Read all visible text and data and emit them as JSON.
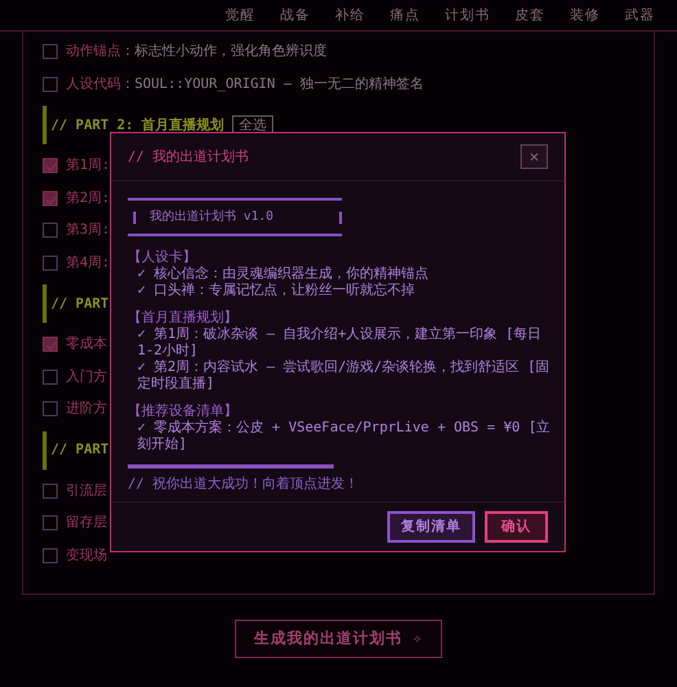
{
  "nav": [
    {
      "label": "觉醒"
    },
    {
      "label": "战备"
    },
    {
      "label": "补给"
    },
    {
      "label": "痛点"
    },
    {
      "label": "计划书"
    },
    {
      "label": "皮套"
    },
    {
      "label": "装修"
    },
    {
      "label": "武器"
    }
  ],
  "background_list": [
    {
      "kind": "item",
      "label": "动作锚点",
      "text": "：标志性小动作，强化角色辨识度",
      "checked": false
    },
    {
      "kind": "item",
      "label": "人设代码",
      "text": "：SOUL::YOUR_ORIGIN — 独一无二的精神签名",
      "checked": false
    },
    {
      "kind": "heading",
      "text": "// PART 2: 首月直播规划",
      "button": "全选"
    },
    {
      "kind": "item",
      "label": "第1周:",
      "checked": true
    },
    {
      "kind": "item",
      "label": "第2周:",
      "checked": true
    },
    {
      "kind": "item",
      "label": "第3周:",
      "checked": false
    },
    {
      "kind": "item",
      "label": "第4周:",
      "checked": false
    },
    {
      "kind": "heading",
      "text": "// PART"
    },
    {
      "kind": "item",
      "label": "零成本",
      "checked": true
    },
    {
      "kind": "item",
      "label": "入门方",
      "checked": false
    },
    {
      "kind": "item",
      "label": "进阶方",
      "checked": false
    },
    {
      "kind": "heading",
      "text": "// PART"
    },
    {
      "kind": "item",
      "label": "引流层",
      "checked": false
    },
    {
      "kind": "item",
      "label": "留存层",
      "checked": false
    },
    {
      "kind": "item",
      "label": "变现场",
      "checked": false
    }
  ],
  "modal": {
    "title": "// 我的出道计划书",
    "close": "×",
    "version": "我的出道计划书 v1.0",
    "sections": [
      {
        "heading": "【人设卡】",
        "items": [
          "✓ 核心信念：由灵魂编织器生成，你的精神锚点",
          "✓ 口头禅：专属记忆点，让粉丝一听就忘不掉"
        ]
      },
      {
        "heading": "【首月直播规划】",
        "items": [
          "✓ 第1周：破冰杂谈 — 自我介绍+人设展示，建立第一印象 [每日1-2小时]",
          "✓ 第2周：内容试水 — 尝试歌回/游戏/杂谈轮换，找到舒适区 [固定时段直播]"
        ]
      },
      {
        "heading": "【推荐设备清单】",
        "items": [
          "✓ 零成本方案：公皮 + VSeeFace/PrprLive + OBS = ¥0 [立刻开始]"
        ]
      }
    ],
    "note": "// 祝你出道大成功！向着顶点进发！",
    "buttons": [
      {
        "label": "复制清单",
        "kind": "secondary"
      },
      {
        "label": "确认",
        "kind": "primary"
      }
    ]
  },
  "generate_button": {
    "label": "生成我的出道计划书 ✧"
  }
}
